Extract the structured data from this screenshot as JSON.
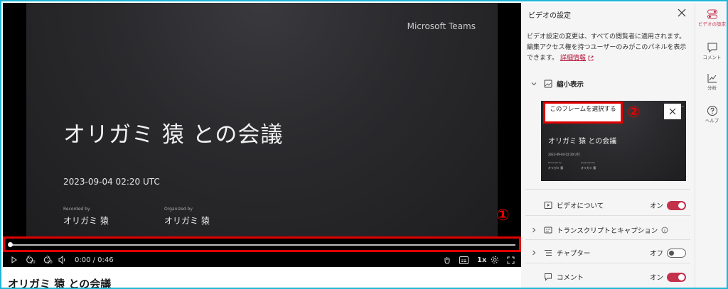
{
  "video": {
    "brand": "Microsoft Teams",
    "title": "オリガミ 猿 との会議",
    "date": "2023-09-04 02:20 UTC",
    "recorded_by_caption": "Recorded by",
    "recorded_by_name": "オリガミ 猿",
    "organized_by_caption": "Organized by",
    "organized_by_name": "オリガミ 猿",
    "time": "0:00 / 0:46",
    "speed": "1x",
    "skip_back": "10",
    "skip_forward": "10",
    "progress": 0.0
  },
  "annotations": {
    "one": "①",
    "two": "②"
  },
  "page_title": "オリガミ 猿 との会議",
  "panel": {
    "title": "ビデオの設定",
    "description": "ビデオ設定の変更は、すべての閲覧者に適用されます。編集アクセス権を持つユーザーのみがこのパネルを表示できます。",
    "learn_more": "詳細情報",
    "thumbnail_section": "縮小表示",
    "select_frame": "このフレームを選択する",
    "thumb_brand": "Microsoft Teams",
    "thumb_title": "オリガミ 猿 との会議",
    "thumb_date": "2023-09-04 02:20 UTC",
    "thumb_p1_caption": "Recorded by",
    "thumb_p1_name": "オリガミ 猿",
    "thumb_p2_caption": "Organized by",
    "thumb_p2_name": "オリガミ 猿",
    "rows": [
      {
        "label": "ビデオについて",
        "state_label": "オン",
        "on": true
      },
      {
        "label": "トランスクリプトとキャプション"
      },
      {
        "label": "チャプター",
        "state_label": "オフ",
        "on": false
      },
      {
        "label": "コメント",
        "state_label": "オン",
        "on": true
      }
    ]
  },
  "rail": {
    "items": [
      {
        "label": "ビデオの設定",
        "active": true
      },
      {
        "label": "コメント"
      },
      {
        "label": "分析"
      },
      {
        "label": "ヘルプ"
      }
    ]
  },
  "colors": {
    "accent": "#c4314b",
    "highlight": "#e10000",
    "frame": "#1fb6d6"
  }
}
